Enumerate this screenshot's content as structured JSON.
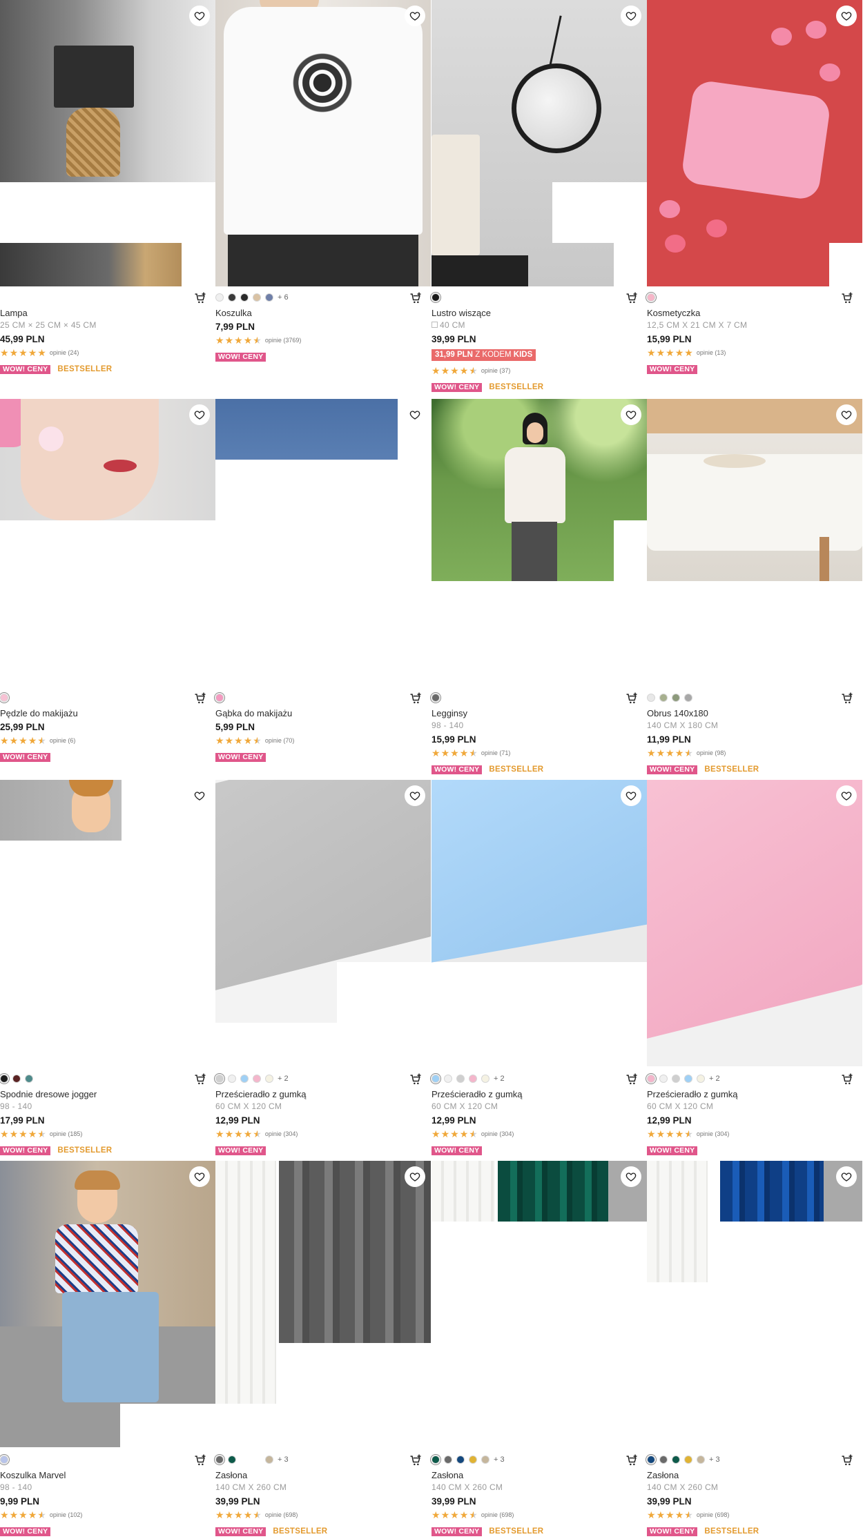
{
  "products": [
    {
      "name": "Lampa",
      "dims": "25 CM × 25 CM × 45 CM",
      "price": "45,99 PLN",
      "reviews": "opinie (24)",
      "wow": "WOW! CENY",
      "bestseller": "BESTSELLER",
      "swatches": [],
      "more": ""
    },
    {
      "name": "Koszulka",
      "dims": "",
      "price": "7,99 PLN",
      "reviews": "opinie (3769)",
      "wow": "WOW! CENY",
      "bestseller": "",
      "swatches": [
        "#f0f0f0",
        "#3b3b3b",
        "#2a2a2a",
        "#d9c2a4",
        "#6f7fa8"
      ],
      "more": "+ 6"
    },
    {
      "name": "Lustro wiszące",
      "dims": "40 CM",
      "price": "39,99 PLN",
      "promo_price": "31,99 PLN",
      "promo_text": "Z KODEM",
      "promo_code": "KIDS",
      "reviews": "opinie (37)",
      "wow": "WOW! CENY",
      "bestseller": "BESTSELLER",
      "swatches": [
        "#1a1a1a"
      ],
      "more": ""
    },
    {
      "name": "Kosmetyczka",
      "dims": "12,5 CM X 21 CM X 7 CM",
      "price": "15,99 PLN",
      "reviews": "opinie (13)",
      "wow": "WOW! CENY",
      "bestseller": "",
      "swatches": [
        "#f6b6c8"
      ],
      "more": ""
    },
    {
      "name": "Pędzle do makijażu",
      "dims": "",
      "price": "25,99 PLN",
      "reviews": "opinie (6)",
      "wow": "WOW! CENY",
      "bestseller": "",
      "swatches": [
        "#f7c2d4"
      ],
      "more": ""
    },
    {
      "name": "Gąbka do makijażu",
      "dims": "",
      "price": "5,99 PLN",
      "reviews": "opinie (70)",
      "wow": "WOW! CENY",
      "bestseller": "",
      "swatches": [
        "#f49ac0"
      ],
      "more": ""
    },
    {
      "name": "Legginsy",
      "dims": "98 - 140",
      "price": "15,99 PLN",
      "reviews": "opinie (71)",
      "wow": "WOW! CENY",
      "bestseller": "BESTSELLER",
      "swatches": [
        "#6a6a6a"
      ],
      "more": ""
    },
    {
      "name": "Obrus 140x180",
      "dims": "140 CM X 180 CM",
      "price": "11,99 PLN",
      "reviews": "opinie (98)",
      "wow": "WOW! CENY",
      "bestseller": "BESTSELLER",
      "swatches": [
        "#e8e8e8",
        "#a7b08f",
        "#8d9a7c",
        "#a8a8a8"
      ],
      "more": ""
    },
    {
      "name": "Spodnie dresowe jogger",
      "dims": "98 - 140",
      "price": "17,99 PLN",
      "reviews": "opinie (185)",
      "wow": "WOW! CENY",
      "bestseller": "BESTSELLER",
      "swatches": [
        "#1d1d1d",
        "#5a2323",
        "#4e8a8a"
      ],
      "more": ""
    },
    {
      "name": "Prześcieradło z gumką",
      "dims": "60 CM X 120 CM",
      "price": "12,99 PLN",
      "reviews": "opinie (304)",
      "wow": "WOW! CENY",
      "bestseller": "",
      "swatches": [
        "#cfcfcf",
        "#f0f0f0",
        "#9fd0f5",
        "#f4b6cb",
        "#f5f2e3"
      ],
      "more": "+ 2"
    },
    {
      "name": "Prześcieradło z gumką",
      "dims": "60 CM X 120 CM",
      "price": "12,99 PLN",
      "reviews": "opinie (304)",
      "wow": "WOW! CENY",
      "bestseller": "",
      "swatches": [
        "#9fd0f5",
        "#f0f0f0",
        "#cfcfcf",
        "#f4b6cb",
        "#f5f2e3"
      ],
      "more": "+ 2"
    },
    {
      "name": "Prześcieradło z gumką",
      "dims": "60 CM X 120 CM",
      "price": "12,99 PLN",
      "reviews": "opinie (304)",
      "wow": "WOW! CENY",
      "bestseller": "",
      "swatches": [
        "#f4b6cb",
        "#f0f0f0",
        "#cfcfcf",
        "#9fd0f5",
        "#f5f2e3"
      ],
      "more": "+ 2"
    },
    {
      "name": "Koszulka Marvel",
      "dims": "98 - 140",
      "price": "9,99 PLN",
      "reviews": "opinie (102)",
      "wow": "WOW! CENY",
      "bestseller": "",
      "swatches": [
        "#b8c4ea"
      ],
      "more": ""
    },
    {
      "name": "Zasłona",
      "dims": "140 CM X 260 CM",
      "price": "39,99 PLN",
      "reviews": "opinie (698)",
      "wow": "WOW! CENY",
      "bestseller": "BESTSELLER",
      "swatches": [
        "#6a6a6a",
        "#0d5a4a",
        "#ffffff",
        "#ffffff",
        "#c5b69c"
      ],
      "more": "+ 3"
    },
    {
      "name": "Zasłona",
      "dims": "140 CM X 260 CM",
      "price": "39,99 PLN",
      "reviews": "opinie (698)",
      "wow": "WOW! CENY",
      "bestseller": "BESTSELLER",
      "swatches": [
        "#0d5a4a",
        "#6a6a6a",
        "#14487e",
        "#e0b334",
        "#c5b69c"
      ],
      "more": "+ 3"
    },
    {
      "name": "Zasłona",
      "dims": "140 CM X 260 CM",
      "price": "39,99 PLN",
      "reviews": "opinie (698)",
      "wow": "WOW! CENY",
      "bestseller": "BESTSELLER",
      "swatches": [
        "#14487e",
        "#6a6a6a",
        "#0d5a4a",
        "#e0b334",
        "#c5b69c"
      ],
      "more": "+ 3"
    }
  ],
  "ratings": [
    5,
    4.5,
    4.5,
    5,
    4.5,
    4.5,
    4.5,
    4.5,
    4.5,
    4.5,
    4.5,
    4.5,
    4.5,
    4.5,
    4.5,
    4.5
  ],
  "icons": {
    "favorite": "heart-outline-icon",
    "cart": "add-to-cart-icon"
  },
  "colors": {
    "wow": "#e0568a",
    "bestseller": "#e39a2e",
    "star": "#f0a83a",
    "promo": "#ea6a6a"
  }
}
